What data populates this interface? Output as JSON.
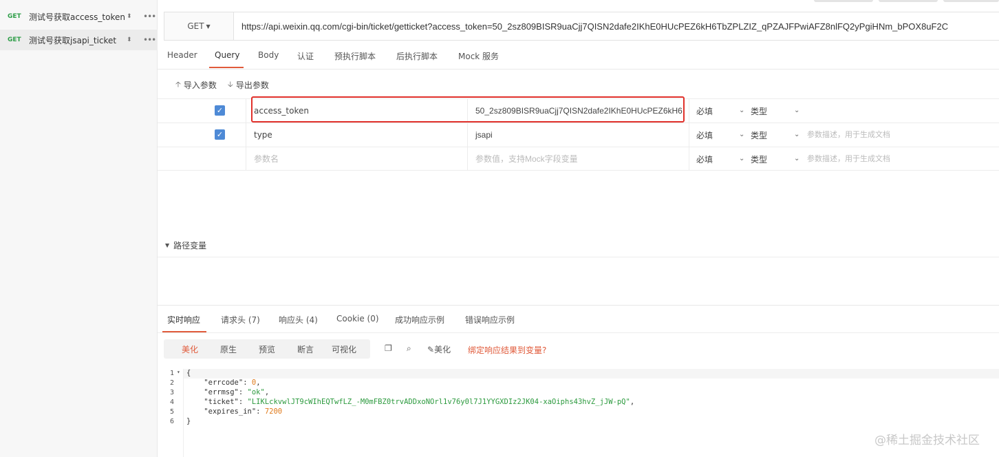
{
  "sidebar": {
    "items": [
      {
        "method": "GET",
        "name": "测试号获取access_token",
        "sort": "⬍",
        "more": "•••"
      },
      {
        "method": "GET",
        "name": "测试号获取jsapi_ticket",
        "sort": "⬍",
        "more": "•••"
      }
    ]
  },
  "request": {
    "method": "GET",
    "url": "https://api.weixin.qq.com/cgi-bin/ticket/getticket?access_token=50_2sz809BISR9uaCjj7QISN2dafe2IKhE0HUcPEZ6kH6TbZPLZIZ_qPZAJFPwiAFZ8nlFQ2yPgiHNm_bPOX8uF2C"
  },
  "req_tabs": [
    "Header",
    "Query",
    "Body",
    "认证",
    "预执行脚本",
    "后执行脚本",
    "Mock 服务"
  ],
  "io": {
    "import_label": "导入参数",
    "export_label": "导出参数"
  },
  "params": [
    {
      "name": "access_token",
      "value": "50_2sz809BISR9uaCjj7QISN2dafe2IKhE0HUcPEZ6kH6",
      "required": "必填",
      "type": "类型",
      "desc": ""
    },
    {
      "name": "type",
      "value": "jsapi",
      "required": "必填",
      "type": "类型",
      "desc": "参数描述，用于生成文档"
    }
  ],
  "new_param": {
    "name_placeholder": "参数名",
    "value_placeholder": "参数值，支持Mock字段变量",
    "required": "必填",
    "type": "类型",
    "desc": "参数描述，用于生成文档"
  },
  "path_vars_label": "路径变量",
  "resp_tabs": [
    "实时响应",
    "请求头 (7)",
    "响应头 (4)",
    "Cookie (0)",
    "成功响应示例",
    "错误响应示例"
  ],
  "fmt_buttons": [
    "美化",
    "原生",
    "预览",
    "断言",
    "可视化"
  ],
  "tools": {
    "beautify": "美化",
    "bind": "绑定响应结果到变量?"
  },
  "response_json": {
    "line1": "{",
    "errcode_key": "\"errcode\"",
    "errcode_val": "0",
    "errmsg_key": "\"errmsg\"",
    "errmsg_val": "\"ok\"",
    "ticket_key": "\"ticket\"",
    "ticket_val": "\"LIKLckvwlJT9cWIhEQTwfLZ_-M0mFBZ0trvADDxoNOrl1v76y0l7J1YYGXDIz2JK04-xaOiphs43hvZ_jJW-pQ\"",
    "expires_key": "\"expires_in\"",
    "expires_val": "7200",
    "line6": "}"
  },
  "watermark": "@稀土掘金技术社区"
}
